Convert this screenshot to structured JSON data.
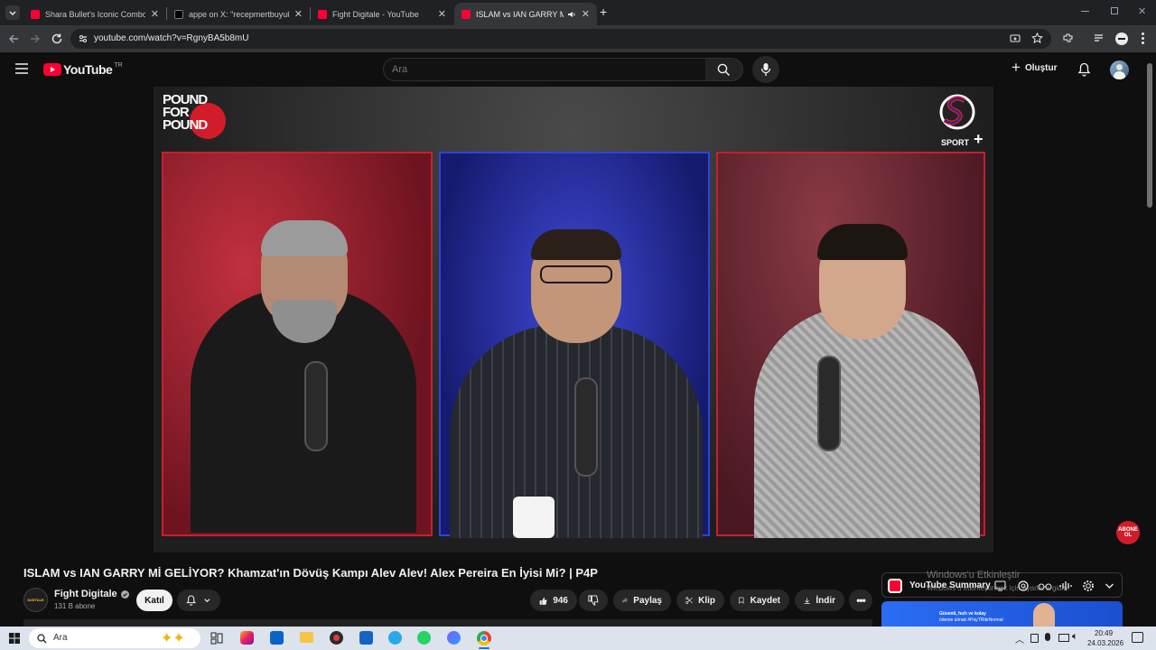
{
  "browser": {
    "tabs": [
      {
        "label": "Shara Bullet's Iconic Combo",
        "icon": "youtube-favicon",
        "active": false
      },
      {
        "label": "appe on X: \"recepmertbuyukad",
        "icon": "x-favicon",
        "active": false
      },
      {
        "label": "Fight Digitale - YouTube",
        "icon": "youtube-favicon",
        "active": false
      },
      {
        "label": "ISLAM vs IAN GARRY Mİ GE",
        "icon": "youtube-favicon",
        "active": true
      }
    ],
    "url": "youtube.com/watch?v=RgnyBA5b8mU",
    "new_tab_glyph": "+",
    "close_glyph": "✕"
  },
  "youtube": {
    "logo_text": "YouTube",
    "region": "TR",
    "search_placeholder": "Ara",
    "create_label": "Oluştur"
  },
  "video": {
    "overlay_logo": "POUND FOR POUND",
    "sport_logo_text": "SPORT",
    "subscribe_badge": "ABONE OL",
    "title": "ISLAM vs IAN GARRY Mİ GELİYOR? Khamzat'ın Dövüş Kampı Alev Alev! Alex Pereira En İyisi Mi? | P4P"
  },
  "channel": {
    "name": "Fight Digitale",
    "subscribers": "131 B abone",
    "avatar_text": "DIGITALE",
    "join_label": "Katıl"
  },
  "actions": {
    "likes": "946",
    "share": "Paylaş",
    "clip": "Klip",
    "save": "Kaydet",
    "download": "İndir"
  },
  "summary_widget": {
    "title": "YouTube Summary",
    "ad_line1": "Güvenli, hızlı ve kolay",
    "ad_line2": "ödeme almak #PayTRileNormal"
  },
  "windows_watermark": {
    "line1": "Windows'u Etkinleştir",
    "line2": "Windows'u etkinleştirmek için Ayarlar'a gidin."
  },
  "taskbar": {
    "search_placeholder": "Ara",
    "time": "20:49",
    "date": "24.03.2026"
  },
  "colors": {
    "youtube_red": "#ff0033",
    "panel_red": "#c4212d",
    "panel_blue": "#2c45d8"
  }
}
